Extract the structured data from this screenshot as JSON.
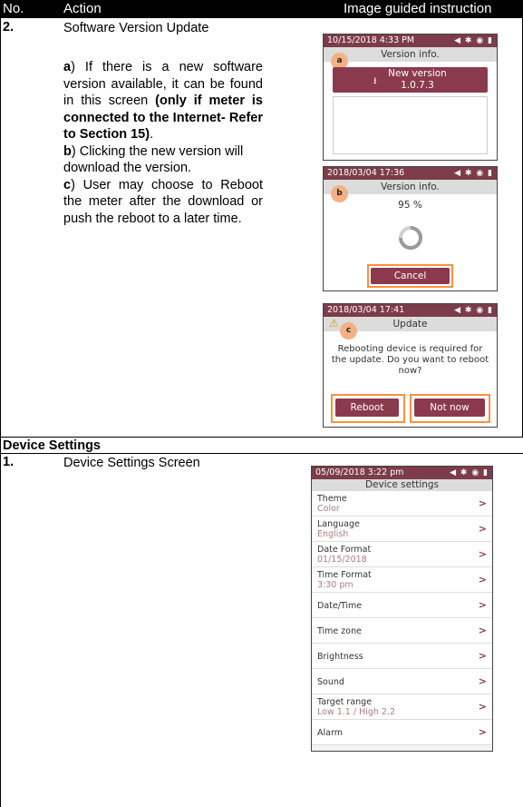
{
  "header": {
    "no": "No.",
    "action": "Action",
    "image": "Image guided instruction"
  },
  "row2": {
    "number": "2.",
    "title": "Software Version Update",
    "para_a_letter": "a",
    "para_a_text": ") If there is a new software version available, it can be found in this screen ",
    "para_a_bold": "(only if meter is connected to the Internet- Refer to Section 15)",
    "para_a_end": ".",
    "para_b_letter": "b",
    "para_b_text": ") Clicking the new version will download the version.",
    "para_c_letter": "c",
    "para_c_text": ") User may choose to Reboot the meter after the download or push the reboot to a later time."
  },
  "screen_a": {
    "time": "10/15/2018 4:33 PM",
    "title": "Version info.",
    "badge": "a",
    "button_line1": "New version",
    "button_line2": "1.0.7.3"
  },
  "screen_b": {
    "time": "2018/03/04 17:36",
    "title": "Version info.",
    "badge": "b",
    "percent": "95 %",
    "cancel": "Cancel"
  },
  "screen_c": {
    "time": "2018/03/04 17:41",
    "title": "Update",
    "badge": "c",
    "message": "Rebooting device is required for the update. Do you want to reboot now?",
    "reboot": "Reboot",
    "not_now": "Not now"
  },
  "section": {
    "title": "Device Settings"
  },
  "row1": {
    "number": "1.",
    "title": "Device Settings Screen"
  },
  "settings_screen": {
    "time": "05/09/2018 3:22 pm",
    "title": "Device settings",
    "items": [
      {
        "label": "Theme",
        "value": "Color"
      },
      {
        "label": "Language",
        "value": "English"
      },
      {
        "label": "Date Format",
        "value": "01/15/2018"
      },
      {
        "label": "Time Format",
        "value": "3:30 pm"
      },
      {
        "label": "Date/Time",
        "value": ""
      },
      {
        "label": "Time zone",
        "value": ""
      },
      {
        "label": "Brightness",
        "value": ""
      },
      {
        "label": "Sound",
        "value": ""
      },
      {
        "label": "Target range",
        "value": "Low 1.1 / High 2.2"
      },
      {
        "label": "Alarm",
        "value": ""
      }
    ]
  },
  "colors": {
    "accent": "#8b3a4e",
    "highlight": "#ff8f3f",
    "badge": "#f4b183"
  },
  "icons": [
    "download-icon",
    "warning-icon",
    "spinner-icon",
    "chevron-right-icon",
    "status-icons"
  ]
}
